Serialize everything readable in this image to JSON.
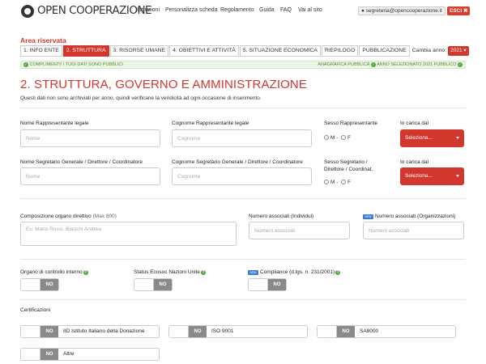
{
  "header": {
    "logo_text": "OPEN COOPERAZIONE",
    "nav": [
      "Istruzioni",
      "Personalizza scheda",
      "Regolamento",
      "Guida",
      "FAQ",
      "Vai al sito"
    ],
    "email": "segreteria@opencooperazione.it",
    "logout_label": "ESCI"
  },
  "area": {
    "title": "Area riservata",
    "tabs": [
      "1. INFO ENTE",
      "2. STRUTTURA",
      "3. RISORSE UMANE",
      "4. OBIETTIVI E ATTIVITÀ",
      "5. SITUAZIONE ECONOMICA",
      "RIEPILOGO",
      "PUBBLICAZIONE"
    ],
    "active_tab": 1,
    "year_label": "Cambia anno:",
    "year_value": "2021"
  },
  "status": {
    "left": "COMPLIMENTI! I TUOI DATI SONO PUBBLICI",
    "right_1": "ANAGRAFICA PUBBLICA",
    "right_2": "ANNO SELEZIONATO 2021 PUBBLICO"
  },
  "section": {
    "title": "2. STRUTTURA, GOVERNO E AMMINISTRAZIONE",
    "subtitle": "Questi dati non sono archiviati per anno, quindi verificane la veridicità ad ogni occasione di inserimento."
  },
  "form": {
    "rep_name_label": "Nome Rappresentante legale",
    "rep_name_placeholder": "Nome",
    "rep_surname_label": "Cognome Rappresentante legale",
    "rep_surname_placeholder": "Cognome",
    "rep_sex_label": "Sesso Rappresentante",
    "rep_since_label": "In carica dal",
    "select_placeholder": "Seleziona...",
    "sec_name_label": "Nome Segretario Generale / Direttore / Coordinatore",
    "sec_name_placeholder": "Nome",
    "sec_surname_label": "Cognome Segretario Generale / Direttore / Coordinatore",
    "sec_surname_placeholder": "Cognome",
    "sec_sex_label_1": "Sesso Segretario /",
    "sec_sex_label_2": "Direttore / Coordinat.",
    "sec_since_label": "In carica dal",
    "sex_m": "M -",
    "sex_f": "F",
    "board_label": "Composizione organo direttivo",
    "board_hint": "(Max 800)",
    "board_placeholder": "Es: Mario Rossi, Bianchi Andrea",
    "members_ind_label": "Numero associati (Individui)",
    "members_ind_placeholder": "Numero associati",
    "members_org_label": "Numero associati (Organizzazioni)",
    "members_org_placeholder": "Numero associati",
    "new_badge": "NEW",
    "control_label": "Organo di controllo interno",
    "ecosoc_label": "Status Ecosoc Nazioni Unite",
    "compliance_label": "Compliance (d.lgs. n. 231/2001)",
    "toggle_no": "NO",
    "certifications_label": "Certificazioni",
    "certifications": [
      "IID Istituto Italiano della Donazione",
      "ISO 9001",
      "SA8000",
      "Altre"
    ]
  },
  "colors": {
    "accent": "#d2372d",
    "success": "#4fa83a",
    "toggle_no": "#8a8a8a",
    "new_badge": "#3a7bd5"
  },
  "icons": {
    "logo": "logo-ring-icon",
    "user": "user-icon",
    "logout": "close-circle-icon",
    "caret": "caret-down-icon",
    "ok": "check-circle-icon",
    "help": "question-circle-icon"
  }
}
